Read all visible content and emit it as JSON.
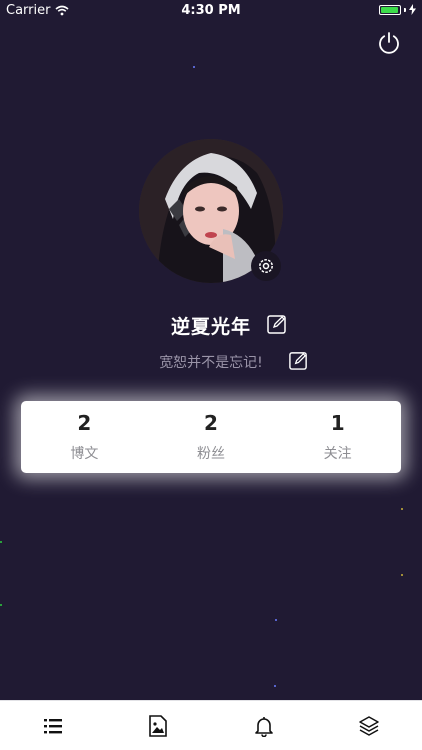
{
  "status_bar": {
    "carrier": "Carrier",
    "time": "4:30 PM",
    "battery_level": 0.95
  },
  "profile": {
    "username": "逆夏光年",
    "bio": "宽恕并不是忘记!"
  },
  "stats": [
    {
      "value": "2",
      "label": "博文"
    },
    {
      "value": "2",
      "label": "粉丝"
    },
    {
      "value": "1",
      "label": "关注"
    }
  ],
  "tab_bar": {
    "icons": [
      "list-icon",
      "image-icon",
      "bell-icon",
      "layers-icon"
    ]
  },
  "colors": {
    "background": "#201a33",
    "card": "#ffffff",
    "text_primary": "#222222",
    "text_secondary": "#8e8e93",
    "battery": "#3ddc4b"
  }
}
